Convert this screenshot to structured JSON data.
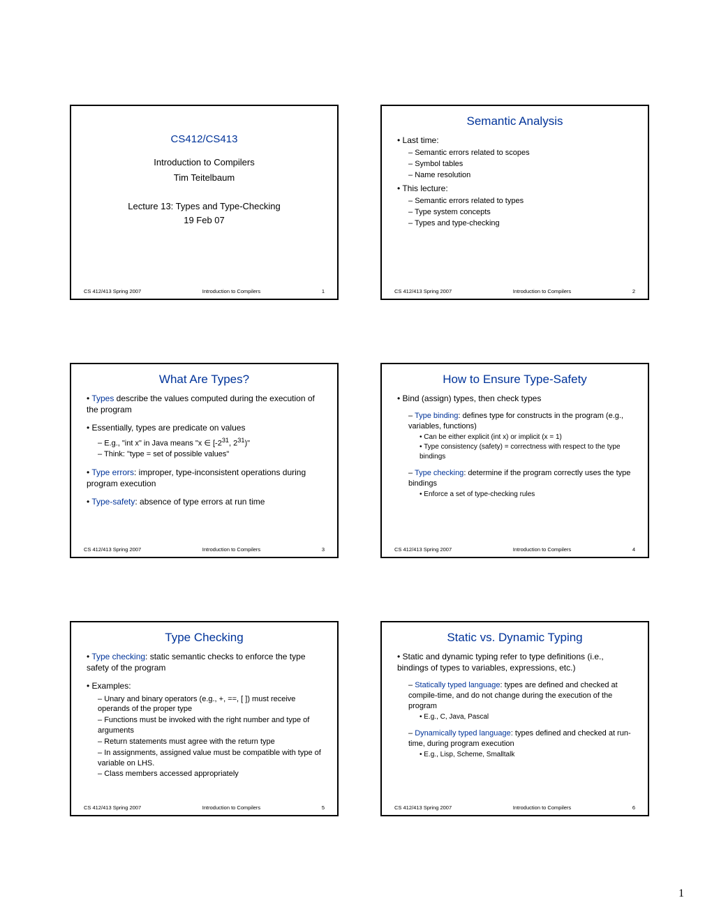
{
  "page_number": "1",
  "footer": {
    "left": "CS 412/413   Spring 2007",
    "mid": "Introduction to Compilers"
  },
  "slides": [
    {
      "num": "1",
      "title_slide": true,
      "course": "CS412/CS413",
      "line1": "Introduction to Compilers",
      "author": "Tim Teitelbaum",
      "lecture": "Lecture 13: Types and Type-Checking",
      "date": "19 Feb 07"
    },
    {
      "num": "2",
      "title": "Semantic Analysis",
      "items": [
        {
          "l": 1,
          "t": "Last time:"
        },
        {
          "l": 2,
          "t": "Semantic errors related to scopes"
        },
        {
          "l": 2,
          "t": "Symbol tables"
        },
        {
          "l": 2,
          "t": "Name resolution"
        },
        {
          "l": 1,
          "t": "This lecture:"
        },
        {
          "l": 2,
          "t": "Semantic errors related to types"
        },
        {
          "l": 2,
          "t": "Type system concepts"
        },
        {
          "l": 2,
          "t": "Types and type-checking"
        }
      ]
    },
    {
      "num": "3",
      "title": "What Are Types?",
      "items": [
        {
          "l": 1,
          "html": "<span class='blue'>Types</span> describe the values computed during the execution of the program"
        },
        {
          "l": 1,
          "cls": "sp",
          "t": "Essentially, types are predicate on values"
        },
        {
          "l": 2,
          "html": "E.g., \"int x\" in Java means \"x ∈ [-2<sup>31</sup>, 2<sup>31</sup>)\""
        },
        {
          "l": 2,
          "t": "Think: \"type = set of possible values\""
        },
        {
          "l": 1,
          "cls": "sp",
          "html": "<span class='blue'>Type errors</span>: improper, type-inconsistent operations during program execution"
        },
        {
          "l": 1,
          "cls": "sp",
          "html": "<span class='blue'>Type-safety</span>: absence of type errors at run time"
        }
      ]
    },
    {
      "num": "4",
      "title": "How to Ensure Type-Safety",
      "items": [
        {
          "l": 1,
          "t": "Bind (assign) types, then check types"
        },
        {
          "l": 2,
          "cls": "sp",
          "html": "<span class='blue'>Type binding</span>: defines type for constructs in the program (e.g., variables, functions)"
        },
        {
          "l": 3,
          "t": "Can be either explicit (int x) or implicit (x = 1)"
        },
        {
          "l": 3,
          "t": "Type consistency (safety) = correctness with respect to the type bindings"
        },
        {
          "l": 2,
          "cls": "sp",
          "html": "<span class='blue'>Type checking</span>: determine if the program correctly uses the type bindings"
        },
        {
          "l": 3,
          "t": "Enforce a set of type-checking rules"
        }
      ]
    },
    {
      "num": "5",
      "title": "Type Checking",
      "items": [
        {
          "l": 1,
          "html": "<span class='blue'>Type checking</span>: static semantic checks to enforce the type safety of the program"
        },
        {
          "l": 1,
          "cls": "sp",
          "t": "Examples:"
        },
        {
          "l": 2,
          "t": "Unary and binary operators (e.g., +, ==, [ ]) must receive operands of the proper type"
        },
        {
          "l": 2,
          "t": "Functions must be invoked with the right number and type of arguments"
        },
        {
          "l": 2,
          "t": "Return statements must agree with the return type"
        },
        {
          "l": 2,
          "t": "In assignments, assigned value must be compatible with type of variable on LHS."
        },
        {
          "l": 2,
          "t": "Class members accessed appropriately"
        }
      ]
    },
    {
      "num": "6",
      "title": "Static vs. Dynamic Typing",
      "items": [
        {
          "l": 1,
          "t": "Static and dynamic typing refer to type definitions (i.e., bindings of types to variables, expressions, etc.)"
        },
        {
          "l": 2,
          "cls": "sp",
          "html": "<span class='blue'>Statically typed language</span>: types are defined and checked at compile-time, and do not change during the execution of the program"
        },
        {
          "l": 3,
          "t": "E.g., C, Java, Pascal"
        },
        {
          "l": 2,
          "cls": "sp",
          "html": "<span class='blue'>Dynamically typed language</span>: types defined and checked at run-time, during program execution"
        },
        {
          "l": 3,
          "t": "E.g., Lisp, Scheme, Smalltalk"
        }
      ]
    }
  ]
}
